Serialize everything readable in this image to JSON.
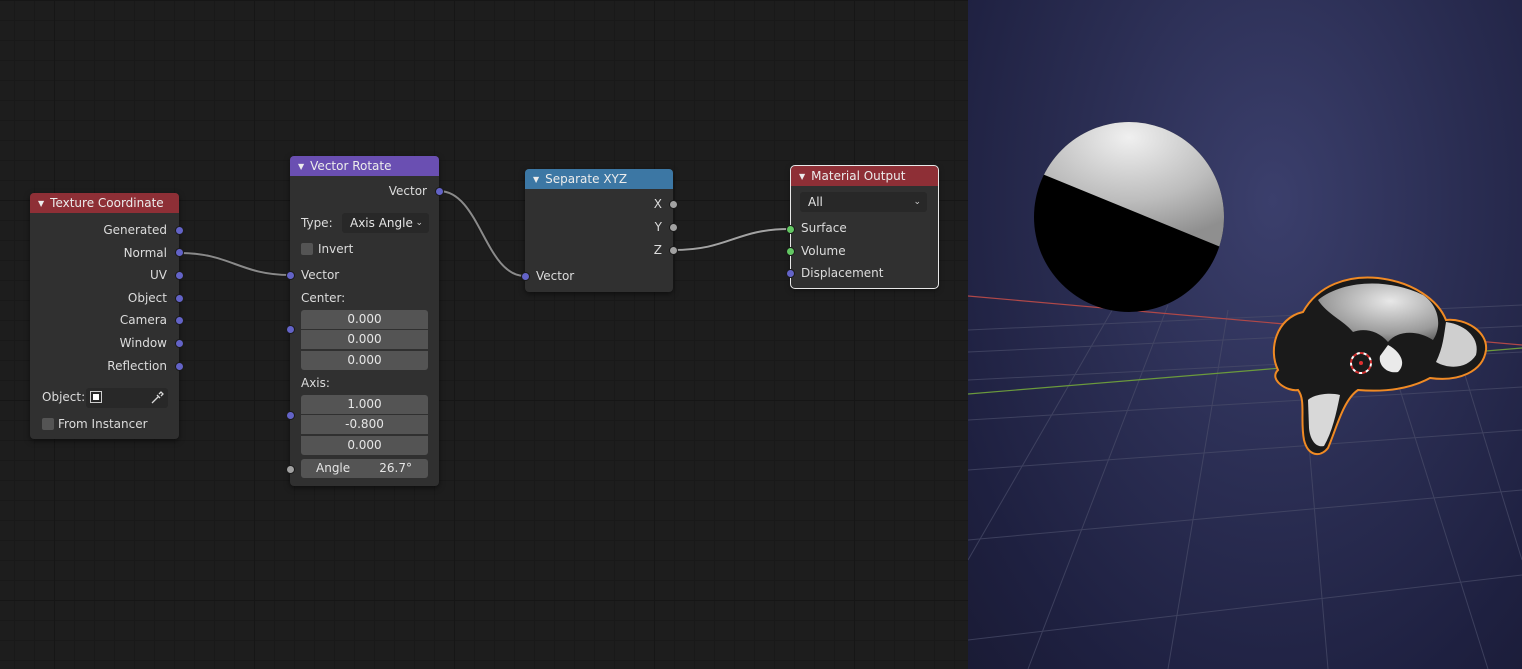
{
  "nodes": {
    "texture_coordinate": {
      "title": "Texture Coordinate",
      "outputs": [
        "Generated",
        "Normal",
        "UV",
        "Object",
        "Camera",
        "Window",
        "Reflection"
      ],
      "object_label": "Object:",
      "from_instancer": "From Instancer"
    },
    "vector_rotate": {
      "title": "Vector Rotate",
      "output": "Vector",
      "type_label": "Type:",
      "type_value": "Axis Angle",
      "invert": "Invert",
      "input_vector": "Vector",
      "center_label": "Center:",
      "center": [
        "0.000",
        "0.000",
        "0.000"
      ],
      "axis_label": "Axis:",
      "axis": [
        "1.000",
        "-0.800",
        "0.000"
      ],
      "angle_label": "Angle",
      "angle_value": "26.7°"
    },
    "separate_xyz": {
      "title": "Separate XYZ",
      "outputs": [
        "X",
        "Y",
        "Z"
      ],
      "input": "Vector"
    },
    "material_output": {
      "title": "Material Output",
      "target": "All",
      "inputs": [
        "Surface",
        "Volume",
        "Displacement"
      ]
    }
  },
  "colors": {
    "header_red": "#8e2f36",
    "header_purple": "#6a4fb2",
    "header_blue": "#3c77a4",
    "socket_vector": "#6363c7",
    "socket_float": "#a1a1a1",
    "socket_shader": "#63c763",
    "selection_outline": "#f08a24"
  },
  "icons": {
    "collapse": "triangle-down-icon",
    "dropdown": "chevron-down-icon",
    "object_picker": "object-icon",
    "eyedropper": "eyedropper-icon",
    "origin": "object-origin-icon"
  }
}
